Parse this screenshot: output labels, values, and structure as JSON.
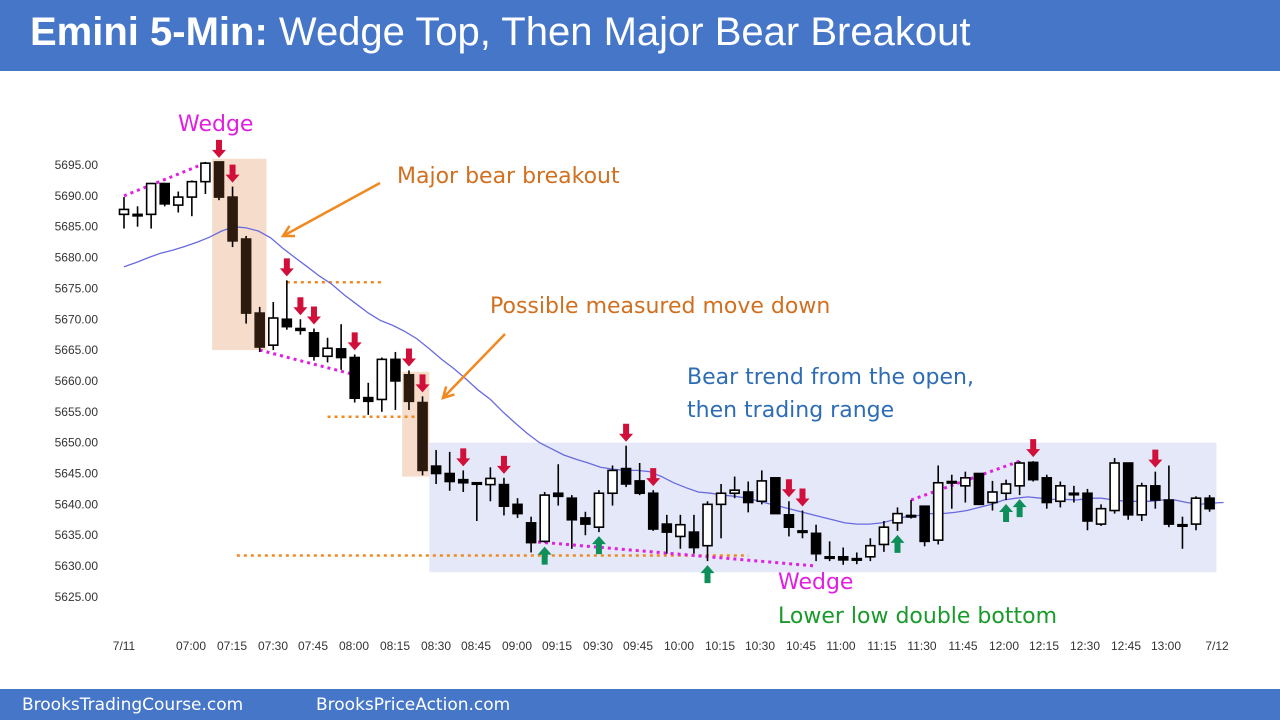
{
  "header": {
    "title_bold": "Emini 5-Min:",
    "title_rest": "Wedge Top, Then Major Bear Breakout"
  },
  "footer": {
    "left": "BrooksTradingCourse.com",
    "right": "BrooksPriceAction.com"
  },
  "colors": {
    "header_bg": "#4676c8",
    "bear_body": "#000000",
    "bear_body_highlight": "#2b1a0d",
    "ema": "#6a6adf",
    "red_arrow": "#d0103a",
    "green_arrow": "#0e8f5a",
    "wedge_dots": "#e020e0",
    "orange": "#f08a20",
    "range_box": "#e4e8f8",
    "breakout_box": "#f5dccb",
    "annotation_orange": "#d07020",
    "annotation_blue": "#2e6db5",
    "annotation_magenta": "#e020e0",
    "annotation_green": "#1a9a2a"
  },
  "annotations": {
    "wedge_top": "Wedge",
    "major_bear_breakout": "Major bear breakout",
    "measured_move": "Possible measured move down",
    "bear_trend_line1": "Bear trend from the open,",
    "bear_trend_line2": "then trading range",
    "wedge_bottom": "Wedge",
    "double_bottom": "Lower low double bottom"
  },
  "chart_data": {
    "type": "candlestick",
    "title": "Emini 5-Min: Wedge Top, Then Major Bear Breakout",
    "ylim": [
      5620,
      5700
    ],
    "yticks": [
      5695,
      5690,
      5685,
      5680,
      5675,
      5670,
      5665,
      5660,
      5655,
      5650,
      5645,
      5640,
      5635,
      5630,
      5625
    ],
    "ytick_labels": [
      "5695.00",
      "5690.00",
      "5685.00",
      "5680.00",
      "5675.00",
      "5670.00",
      "5665.00",
      "5660.00",
      "5655.00",
      "5650.00",
      "5645.00",
      "5640.00",
      "5635.00",
      "5630.00",
      "5625.00"
    ],
    "xtick_labels": [
      "7/11",
      "07:00",
      "07:15",
      "07:30",
      "07:45",
      "08:00",
      "08:15",
      "08:30",
      "08:45",
      "09:00",
      "09:15",
      "09:30",
      "09:45",
      "10:00",
      "10:15",
      "10:30",
      "10:45",
      "11:00",
      "11:15",
      "11:30",
      "11:45",
      "12:00",
      "12:15",
      "12:30",
      "12:45",
      "13:00",
      "7/12"
    ],
    "candles": [
      {
        "o": 5687.0,
        "h": 5689.8,
        "l": 5684.7,
        "c": 5687.8
      },
      {
        "o": 5687.0,
        "h": 5688.3,
        "l": 5685.0,
        "c": 5687.0
      },
      {
        "o": 5687.0,
        "h": 5692.0,
        "l": 5684.7,
        "c": 5692.0
      },
      {
        "o": 5692.0,
        "h": 5692.0,
        "l": 5688.3,
        "c": 5688.7
      },
      {
        "o": 5688.5,
        "h": 5690.7,
        "l": 5687.3,
        "c": 5689.8
      },
      {
        "o": 5689.8,
        "h": 5692.5,
        "l": 5686.7,
        "c": 5692.3
      },
      {
        "o": 5692.3,
        "h": 5695.5,
        "l": 5690.3,
        "c": 5695.3
      },
      {
        "o": 5695.5,
        "h": 5695.5,
        "l": 5689.3,
        "c": 5689.8
      },
      {
        "o": 5689.8,
        "h": 5691.5,
        "l": 5681.7,
        "c": 5682.7
      },
      {
        "o": 5683.0,
        "h": 5683.5,
        "l": 5669.3,
        "c": 5671.0
      },
      {
        "o": 5671.0,
        "h": 5672.0,
        "l": 5664.7,
        "c": 5665.5
      },
      {
        "o": 5665.8,
        "h": 5672.8,
        "l": 5665.0,
        "c": 5670.2
      },
      {
        "o": 5670.0,
        "h": 5676.3,
        "l": 5668.3,
        "c": 5668.8
      },
      {
        "o": 5668.5,
        "h": 5670.0,
        "l": 5667.5,
        "c": 5668.2
      },
      {
        "o": 5667.8,
        "h": 5668.5,
        "l": 5663.3,
        "c": 5664.0
      },
      {
        "o": 5664.0,
        "h": 5667.0,
        "l": 5663.0,
        "c": 5665.3
      },
      {
        "o": 5665.2,
        "h": 5669.2,
        "l": 5661.8,
        "c": 5663.8
      },
      {
        "o": 5663.8,
        "h": 5664.3,
        "l": 5656.5,
        "c": 5657.2
      },
      {
        "o": 5657.3,
        "h": 5659.7,
        "l": 5654.5,
        "c": 5656.7
      },
      {
        "o": 5657.0,
        "h": 5663.8,
        "l": 5655.0,
        "c": 5663.5
      },
      {
        "o": 5663.5,
        "h": 5664.7,
        "l": 5655.3,
        "c": 5660.0
      },
      {
        "o": 5661.0,
        "h": 5661.7,
        "l": 5655.3,
        "c": 5656.7
      },
      {
        "o": 5656.5,
        "h": 5657.5,
        "l": 5644.7,
        "c": 5645.5
      },
      {
        "o": 5646.2,
        "h": 5648.8,
        "l": 5643.3,
        "c": 5645.0
      },
      {
        "o": 5645.0,
        "h": 5648.5,
        "l": 5642.2,
        "c": 5643.7
      },
      {
        "o": 5644.0,
        "h": 5645.5,
        "l": 5642.0,
        "c": 5643.5
      },
      {
        "o": 5643.5,
        "h": 5643.5,
        "l": 5637.3,
        "c": 5643.5
      },
      {
        "o": 5643.2,
        "h": 5646.0,
        "l": 5640.5,
        "c": 5644.2
      },
      {
        "o": 5643.2,
        "h": 5644.3,
        "l": 5638.2,
        "c": 5639.7
      },
      {
        "o": 5640.0,
        "h": 5641.0,
        "l": 5637.8,
        "c": 5638.5
      },
      {
        "o": 5637.0,
        "h": 5638.0,
        "l": 5632.2,
        "c": 5633.8
      },
      {
        "o": 5634.0,
        "h": 5642.0,
        "l": 5633.8,
        "c": 5641.5
      },
      {
        "o": 5641.8,
        "h": 5646.5,
        "l": 5639.8,
        "c": 5641.3
      },
      {
        "o": 5641.0,
        "h": 5641.5,
        "l": 5632.8,
        "c": 5637.5
      },
      {
        "o": 5637.8,
        "h": 5638.8,
        "l": 5635.0,
        "c": 5636.8
      },
      {
        "o": 5636.3,
        "h": 5642.3,
        "l": 5635.5,
        "c": 5641.8
      },
      {
        "o": 5641.8,
        "h": 5646.3,
        "l": 5639.8,
        "c": 5645.5
      },
      {
        "o": 5645.8,
        "h": 5649.5,
        "l": 5642.8,
        "c": 5643.3
      },
      {
        "o": 5643.8,
        "h": 5646.7,
        "l": 5641.5,
        "c": 5641.8
      },
      {
        "o": 5641.8,
        "h": 5642.3,
        "l": 5635.7,
        "c": 5636.0
      },
      {
        "o": 5636.8,
        "h": 5638.3,
        "l": 5632.0,
        "c": 5635.5
      },
      {
        "o": 5634.8,
        "h": 5638.3,
        "l": 5632.8,
        "c": 5636.7
      },
      {
        "o": 5635.5,
        "h": 5638.3,
        "l": 5632.0,
        "c": 5633.0
      },
      {
        "o": 5633.3,
        "h": 5640.5,
        "l": 5630.8,
        "c": 5640.0
      },
      {
        "o": 5640.0,
        "h": 5643.3,
        "l": 5634.5,
        "c": 5641.8
      },
      {
        "o": 5641.8,
        "h": 5644.5,
        "l": 5641.0,
        "c": 5642.3
      },
      {
        "o": 5642.0,
        "h": 5643.7,
        "l": 5638.7,
        "c": 5640.3
      },
      {
        "o": 5640.5,
        "h": 5645.5,
        "l": 5640.0,
        "c": 5643.8
      },
      {
        "o": 5644.3,
        "h": 5644.3,
        "l": 5638.5,
        "c": 5638.5
      },
      {
        "o": 5638.3,
        "h": 5640.5,
        "l": 5634.8,
        "c": 5636.3
      },
      {
        "o": 5635.7,
        "h": 5639.0,
        "l": 5634.5,
        "c": 5635.7
      },
      {
        "o": 5635.3,
        "h": 5636.7,
        "l": 5630.8,
        "c": 5632.0
      },
      {
        "o": 5631.5,
        "h": 5634.0,
        "l": 5630.8,
        "c": 5631.5
      },
      {
        "o": 5631.5,
        "h": 5633.0,
        "l": 5630.2,
        "c": 5631.0
      },
      {
        "o": 5631.2,
        "h": 5632.2,
        "l": 5630.3,
        "c": 5631.2
      },
      {
        "o": 5631.5,
        "h": 5634.5,
        "l": 5630.8,
        "c": 5633.3
      },
      {
        "o": 5633.5,
        "h": 5637.3,
        "l": 5632.3,
        "c": 5636.3
      },
      {
        "o": 5637.0,
        "h": 5639.5,
        "l": 5635.7,
        "c": 5638.5
      },
      {
        "o": 5638.2,
        "h": 5640.7,
        "l": 5637.7,
        "c": 5638.2
      },
      {
        "o": 5639.7,
        "h": 5639.7,
        "l": 5633.2,
        "c": 5634.0
      },
      {
        "o": 5634.2,
        "h": 5646.3,
        "l": 5633.5,
        "c": 5643.5
      },
      {
        "o": 5643.7,
        "h": 5644.8,
        "l": 5639.3,
        "c": 5643.7
      },
      {
        "o": 5643.0,
        "h": 5645.3,
        "l": 5640.3,
        "c": 5644.3
      },
      {
        "o": 5645.0,
        "h": 5645.0,
        "l": 5640.0,
        "c": 5640.0
      },
      {
        "o": 5640.3,
        "h": 5643.8,
        "l": 5639.0,
        "c": 5642.0
      },
      {
        "o": 5641.8,
        "h": 5644.0,
        "l": 5640.7,
        "c": 5643.3
      },
      {
        "o": 5643.0,
        "h": 5647.0,
        "l": 5641.5,
        "c": 5646.7
      },
      {
        "o": 5646.8,
        "h": 5647.0,
        "l": 5643.7,
        "c": 5644.0
      },
      {
        "o": 5644.3,
        "h": 5644.8,
        "l": 5639.3,
        "c": 5640.3
      },
      {
        "o": 5640.5,
        "h": 5643.7,
        "l": 5639.5,
        "c": 5643.0
      },
      {
        "o": 5641.8,
        "h": 5643.0,
        "l": 5640.3,
        "c": 5641.8
      },
      {
        "o": 5641.8,
        "h": 5642.5,
        "l": 5635.8,
        "c": 5637.3
      },
      {
        "o": 5636.8,
        "h": 5640.0,
        "l": 5636.5,
        "c": 5639.3
      },
      {
        "o": 5639.0,
        "h": 5647.5,
        "l": 5638.5,
        "c": 5646.7
      },
      {
        "o": 5646.7,
        "h": 5646.7,
        "l": 5637.5,
        "c": 5638.3
      },
      {
        "o": 5638.3,
        "h": 5643.5,
        "l": 5637.3,
        "c": 5643.0
      },
      {
        "o": 5643.0,
        "h": 5645.3,
        "l": 5639.3,
        "c": 5640.7
      },
      {
        "o": 5640.7,
        "h": 5646.3,
        "l": 5636.3,
        "c": 5636.8
      },
      {
        "o": 5636.7,
        "h": 5638.0,
        "l": 5632.8,
        "c": 5636.7
      },
      {
        "o": 5636.8,
        "h": 5641.3,
        "l": 5635.8,
        "c": 5641.0
      },
      {
        "o": 5641.0,
        "h": 5641.5,
        "l": 5638.8,
        "c": 5639.3
      }
    ],
    "ema": [
      5678.5,
      5679.2,
      5680.0,
      5680.7,
      5681.2,
      5681.8,
      5682.5,
      5683.3,
      5684.3,
      5685.0,
      5684.8,
      5684.3,
      5683.2,
      5681.5,
      5680.0,
      5678.5,
      5677.0,
      5675.7,
      5674.0,
      5672.5,
      5671.0,
      5669.8,
      5669.0,
      5668.0,
      5666.8,
      5665.2,
      5663.5,
      5662.0,
      5660.3,
      5658.5,
      5657.0,
      5655.0,
      5653.2,
      5651.5,
      5650.0,
      5649.0,
      5648.0,
      5647.3,
      5646.7,
      5646.0,
      5645.7,
      5645.5,
      5645.5,
      5645.3,
      5644.5,
      5643.5,
      5642.7,
      5642.0,
      5641.8,
      5641.5,
      5641.3,
      5641.0,
      5640.5,
      5640.0,
      5639.5,
      5639.0,
      5638.5,
      5638.0,
      5637.5,
      5637.0,
      5636.8,
      5636.8,
      5637.0,
      5637.5,
      5638.0,
      5638.2,
      5638.5,
      5638.5,
      5638.7,
      5639.0,
      5639.5,
      5640.0,
      5640.7,
      5641.0,
      5641.2,
      5641.0,
      5640.8,
      5640.8,
      5640.7,
      5641.0,
      5641.0,
      5640.7,
      5640.5,
      5640.5,
      5640.5,
      5640.7,
      5640.7,
      5640.3,
      5640.0,
      5640.2,
      5640.3
    ],
    "red_arrow_bars": [
      7,
      8,
      12,
      13,
      14,
      17,
      21,
      22,
      25,
      28,
      37,
      39,
      49,
      50,
      67,
      76
    ],
    "green_arrow_bars": [
      31,
      35,
      43,
      57,
      65,
      66
    ],
    "levels": [
      {
        "name": "orange-top",
        "price": 5676.0,
        "from_bar": 12,
        "to_bar": 19
      },
      {
        "name": "orange-mid",
        "price": 5654.2,
        "from_bar": 15,
        "to_bar": 22
      },
      {
        "name": "orange-low",
        "price": 5631.7,
        "from_bar": 12,
        "to_bar": 46
      }
    ],
    "wedge_lines": [
      {
        "from": [
          0,
          5690.0
        ],
        "to": [
          6,
          5695.3
        ]
      },
      {
        "from": [
          10,
          5665.0
        ],
        "to": [
          17,
          5661.0
        ]
      },
      {
        "from": [
          30,
          5634.0
        ],
        "to": [
          51,
          5630.0
        ]
      },
      {
        "from": [
          58,
          5640.7
        ],
        "to": [
          66,
          5647.0
        ]
      }
    ],
    "range_box": {
      "from_bar": 22.5,
      "to_bar": 80.5,
      "low": 5629.0,
      "high": 5650.0
    },
    "breakout_boxes": [
      {
        "from_bar": 6.5,
        "to_bar": 10.5,
        "low": 5665.0,
        "high": 5696.0
      },
      {
        "from_bar": 20.5,
        "to_bar": 22.5,
        "low": 5644.5,
        "high": 5661.5
      }
    ]
  }
}
